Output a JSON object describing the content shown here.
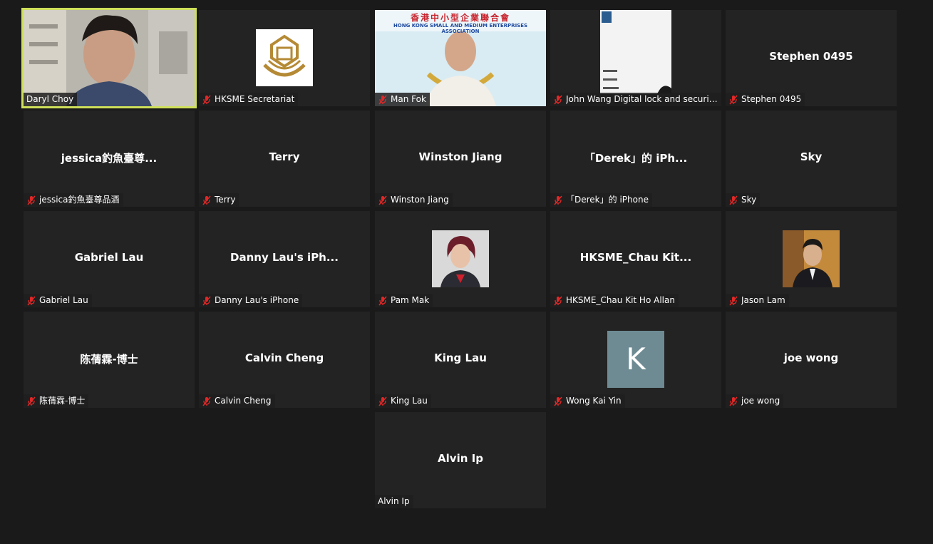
{
  "participants": [
    {
      "display_name": "Daryl Choy",
      "label": "Daryl Choy",
      "muted": false,
      "video": true
    },
    {
      "display_name": "HKSME Secretariat",
      "label": "HKSME Secretariat",
      "muted": true,
      "logo": true
    },
    {
      "display_name": "Man Fok",
      "label": "Man Fok",
      "muted": true,
      "video": true,
      "banner_cn": "香港中小型企業聯合會",
      "banner_en": "HONG KONG SMALL AND MEDIUM ENTERPRISES ASSOCIATION"
    },
    {
      "display_name": "John Wang Digital lock and security...",
      "label": "John Wang Digital lock and security...",
      "muted": true,
      "video": true
    },
    {
      "display_name": "Stephen 0495",
      "label": "Stephen 0495",
      "muted": true
    },
    {
      "display_name": "jessica釣魚臺尊...",
      "label": "jessica釣魚臺尊品酒",
      "muted": true
    },
    {
      "display_name": "Terry",
      "label": "Terry",
      "muted": true
    },
    {
      "display_name": "Winston Jiang",
      "label": "Winston Jiang",
      "muted": true
    },
    {
      "display_name": "「Derek」的 iPh...",
      "label": "「Derek」的 iPhone",
      "muted": true
    },
    {
      "display_name": "Sky",
      "label": "Sky",
      "muted": true
    },
    {
      "display_name": "Gabriel Lau",
      "label": "Gabriel Lau",
      "muted": true
    },
    {
      "display_name": "Danny Lau's iPh...",
      "label": "Danny Lau's iPhone",
      "muted": true
    },
    {
      "display_name": "Pam Mak",
      "label": "Pam Mak",
      "muted": true,
      "photo": true
    },
    {
      "display_name": "HKSME_Chau Kit...",
      "label": "HKSME_Chau Kit Ho Allan",
      "muted": true
    },
    {
      "display_name": "Jason Lam",
      "label": "Jason Lam",
      "muted": true,
      "photo": true
    },
    {
      "display_name": "陈蒨霖-博士",
      "label": "陈蒨霖-博士",
      "muted": true
    },
    {
      "display_name": "Calvin Cheng",
      "label": "Calvin Cheng",
      "muted": true
    },
    {
      "display_name": "King Lau",
      "label": "King Lau",
      "muted": true
    },
    {
      "display_name": "Wong Kai Yin",
      "label": "Wong Kai Yin",
      "muted": true,
      "avatar_letter": "K"
    },
    {
      "display_name": "joe wong",
      "label": "joe wong",
      "muted": true
    },
    {
      "display_name": "Alvin Ip",
      "label": "Alvin Ip",
      "muted": false
    }
  ],
  "colors": {
    "background": "#1a1a1a",
    "tile": "#232323",
    "active_speaker_border": "#cfe05a",
    "muted_icon": "#e02828",
    "avatar_letter_bg": "#6e8b94"
  }
}
